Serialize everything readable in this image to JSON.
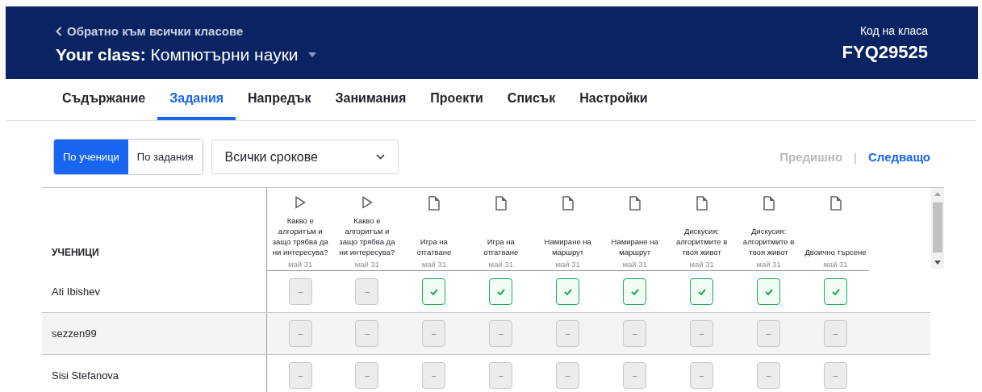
{
  "header": {
    "back_link": "Обратно към всички класове",
    "class_title": "**Your class:** Компютърни науки",
    "code_label": "Код на класа",
    "code": "FYQ29525"
  },
  "tabs": [
    {
      "label": "Съдържание",
      "selected": false
    },
    {
      "label": "Задания",
      "selected": true
    },
    {
      "label": "Напредък",
      "selected": false
    },
    {
      "label": "Занимания",
      "selected": false
    },
    {
      "label": "Проекти",
      "selected": false
    },
    {
      "label": "Списък",
      "selected": false
    },
    {
      "label": "Настройки",
      "selected": false
    }
  ],
  "view_toggle": [
    {
      "label": "По ученици",
      "selected": true
    },
    {
      "label": "По задания",
      "selected": false
    }
  ],
  "period_select": {
    "value": "Всички срокове"
  },
  "pager": {
    "previous": {
      "label": "Предишно",
      "disabled": true
    },
    "separator": "|",
    "next": {
      "label": "Следващо",
      "disabled": false
    }
  },
  "table": {
    "students_heading": "УЧЕНИЦИ",
    "columns": [
      {
        "kind": "video",
        "title": "Какво е алгоритъм и защо трябва да ни интересува?",
        "date": "май 31"
      },
      {
        "kind": "video",
        "title": "Какво е алгоритъм и защо трябва да ни интересува?",
        "date": "май 31"
      },
      {
        "kind": "article",
        "title": "Игра на отгатване",
        "date": "май 31"
      },
      {
        "kind": "article",
        "title": "Игра на отгатване",
        "date": "май 31"
      },
      {
        "kind": "article",
        "title": "Намиране на маршрут",
        "date": "май 31"
      },
      {
        "kind": "article",
        "title": "Намиране на маршрут",
        "date": "май 31"
      },
      {
        "kind": "article",
        "title": "Дискусия: алгоритмите в твоя живот",
        "date": "май 31"
      },
      {
        "kind": "article",
        "title": "Дискусия: алгоритмите в твоя живот",
        "date": "май 31"
      },
      {
        "kind": "article",
        "title": "Двоично търсене",
        "date": "май 31"
      }
    ],
    "rows": [
      {
        "name": "Ati Ibishev",
        "highlighted": false,
        "cells": [
          {
            "done": false,
            "text": "–"
          },
          {
            "done": false,
            "text": "–"
          },
          {
            "done": true
          },
          {
            "done": true
          },
          {
            "done": true
          },
          {
            "done": true
          },
          {
            "done": true
          },
          {
            "done": true
          },
          {
            "done": true
          }
        ]
      },
      {
        "name": "sezzen99",
        "highlighted": true,
        "cells": [
          {
            "done": false,
            "text": "–"
          },
          {
            "done": false,
            "text": "–"
          },
          {
            "done": false,
            "text": "–"
          },
          {
            "done": false,
            "text": "–"
          },
          {
            "done": false,
            "text": "–"
          },
          {
            "done": false,
            "text": "–"
          },
          {
            "done": false,
            "text": "–"
          },
          {
            "done": false,
            "text": "–"
          },
          {
            "done": false,
            "text": "–"
          }
        ]
      },
      {
        "name": "Sisi Stefanova",
        "highlighted": false,
        "cells": [
          {
            "done": false,
            "text": "–"
          },
          {
            "done": false,
            "text": "–"
          },
          {
            "done": false,
            "text": "–"
          },
          {
            "done": false,
            "text": "–"
          },
          {
            "done": false,
            "text": "–"
          },
          {
            "done": false,
            "text": "–"
          },
          {
            "done": false,
            "text": "–"
          },
          {
            "done": false,
            "text": "–"
          },
          {
            "done": false,
            "text": "–"
          }
        ]
      }
    ]
  }
}
